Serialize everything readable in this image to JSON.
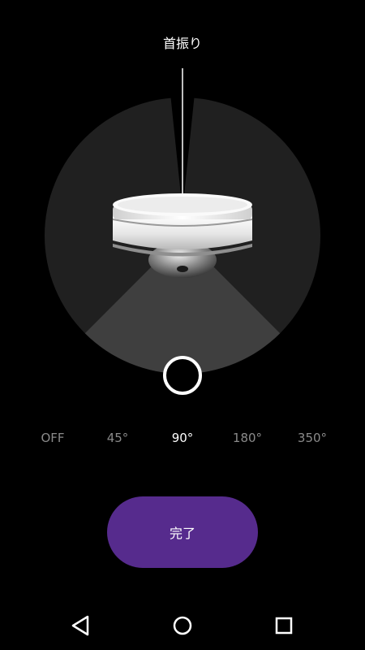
{
  "header": {
    "title": "首振り"
  },
  "oscillation": {
    "options": [
      "OFF",
      "45°",
      "90°",
      "180°",
      "350°"
    ],
    "selected_index": 2
  },
  "actions": {
    "done_label": "完了"
  },
  "colors": {
    "background": "#000000",
    "dial_dark": "#202020",
    "sweep_light": "#3f3f3f",
    "accent_purple": "#562b8d",
    "option_inactive": "#8a8a8a",
    "option_active": "#ffffff"
  },
  "navigation": {
    "icons": [
      "back-icon",
      "home-icon",
      "recents-icon"
    ]
  }
}
